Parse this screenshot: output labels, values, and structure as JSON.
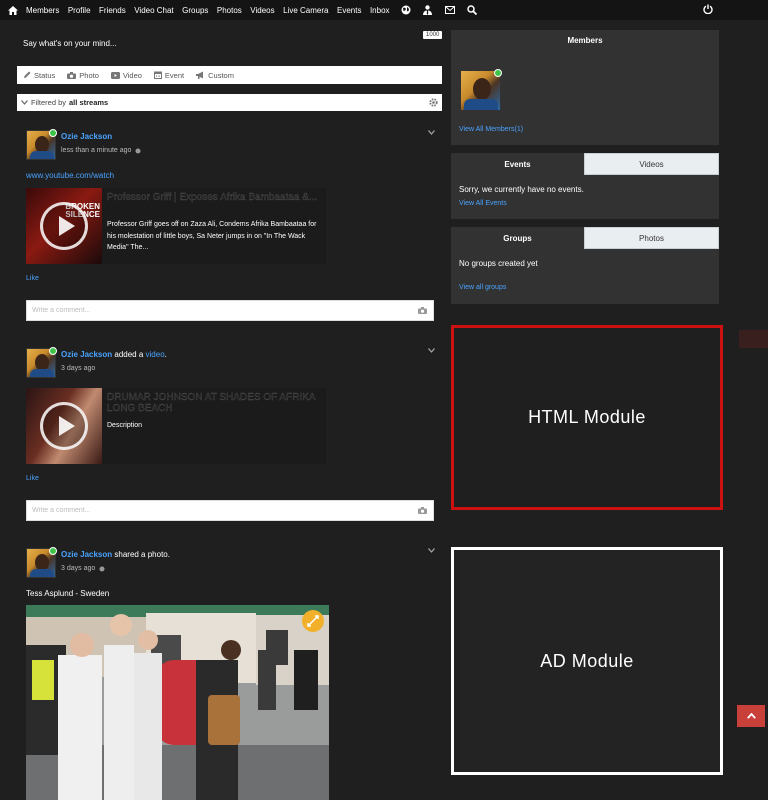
{
  "nav": {
    "links": [
      "Members",
      "Profile",
      "Friends",
      "Video Chat",
      "Groups",
      "Photos",
      "Videos",
      "Live Camera",
      "Events",
      "Inbox"
    ],
    "icons": [
      "home-icon",
      "globe-icon",
      "user-tie-icon",
      "envelope-icon",
      "search-icon",
      "power-icon"
    ]
  },
  "composer": {
    "prompt": "Say what's on your mind...",
    "counter": "1000",
    "tabs": [
      "Status",
      "Photo",
      "Video",
      "Event",
      "Custom"
    ]
  },
  "filter": {
    "prefix": "Filtered by",
    "value": "all streams"
  },
  "posts": [
    {
      "author": "Ozie Jackson",
      "time": "less than a minute ago",
      "link": "www.youtube.com/watch",
      "embed_title": "Professor Griff | Exposes Afrika Bambaataa &...",
      "embed_desc": "Professor Griff goes off on Zaza Ali, Condems Afrika Bambaataa for his molestation of little boys, Sa Neter jumps in on \"In The Wack Media\" The...",
      "thumb_text": "BROKEN SILENCE",
      "like": "Like",
      "comment_placeholder": "Write a comment..."
    },
    {
      "author": "Ozie Jackson",
      "action": "added a",
      "action_link": "video",
      "time": "3 days ago",
      "embed_title": "DRUMAR JOHNSON AT SHADES OF AFRIKA LONG BEACH",
      "embed_desc": "Description",
      "like": "Like",
      "comment_placeholder": "Write a comment..."
    },
    {
      "author": "Ozie Jackson",
      "action": "shared a photo.",
      "time": "3 days ago",
      "caption": "Tess Asplund - Sweden"
    }
  ],
  "sidebar": {
    "members": {
      "title": "Members",
      "view_all": "View All Members(1)"
    },
    "events": {
      "tab_active": "Events",
      "tab_other": "Videos",
      "empty": "Sorry, we currently have no events.",
      "view_all": "View All Events"
    },
    "groups": {
      "tab_active": "Groups",
      "tab_other": "Photos",
      "empty": "No groups created yet",
      "view_all": "View all groups"
    }
  },
  "modules": {
    "html": "HTML Module",
    "ad": "AD Module"
  },
  "colors": {
    "background": "#1f1f1f",
    "link": "#4aa3ff",
    "html_module_border": "#cc1111",
    "ad_module_border": "#ffffff",
    "scroll_button": "#c9403b",
    "online": "#3fc44a"
  }
}
